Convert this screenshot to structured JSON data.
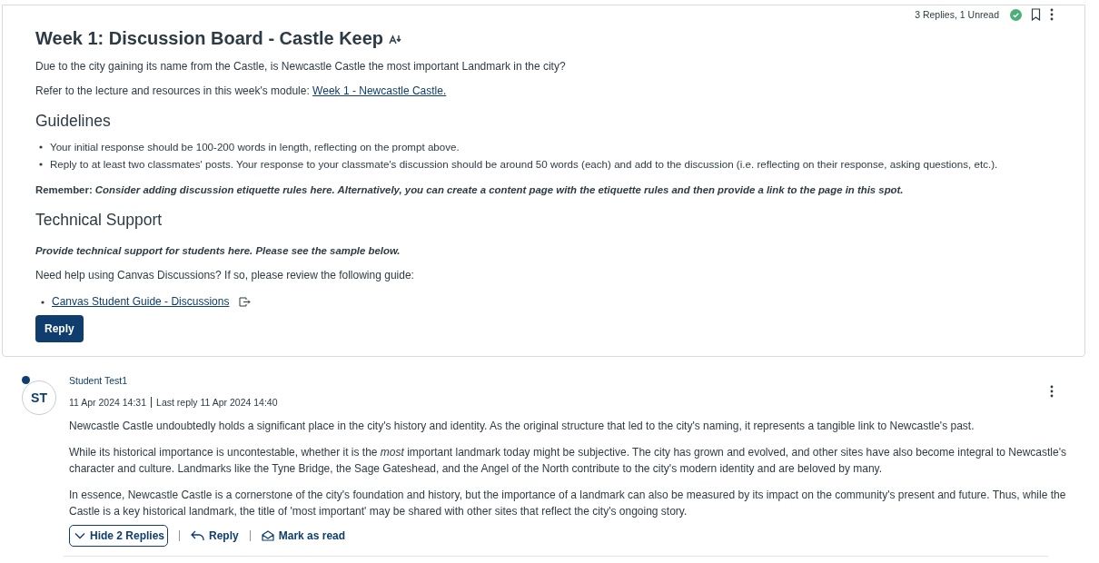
{
  "topic": {
    "status": "3 Replies, 1 Unread",
    "published": true,
    "bookmarked": false,
    "title": "Week 1: Discussion Board - Castle Keep",
    "blocks": [
      {
        "kind": "paragraph",
        "text": "Due to the city gaining its name from the Castle, is Newcastle Castle the most important Landmark in the city?"
      },
      {
        "kind": "paragraph",
        "text": "Refer to the lecture and resources in this week's module: ",
        "link": "Week 1 - Newcastle Castle."
      },
      {
        "kind": "heading",
        "text": "Guidelines"
      },
      {
        "kind": "list",
        "items": [
          "Your initial response should be 100-200 words in length, reflecting on the prompt above.",
          "Reply to at least two classmates' posts. Your response to your classmate's discussion should be around 50 words (each) and add to the discussion (i.e. reflecting on their response, asking questions, etc.)."
        ]
      },
      {
        "kind": "note",
        "text": "Remember: *Consider adding discussion etiquette rules here. Alternatively, you can create a content page with the etiquette rules and then provide a link to the page in this spot.*"
      },
      {
        "kind": "heading",
        "text": "Technical Support"
      },
      {
        "kind": "emphasis",
        "text": "Provide technical support for students here. Please see the sample below."
      },
      {
        "kind": "paragraph",
        "text": "Need help using Canvas Discussions? If so, please review the following guide:"
      },
      {
        "kind": "links",
        "items": [
          "Canvas Student Guide - Discussions"
        ]
      }
    ],
    "reply_button": "Reply"
  },
  "entry": {
    "initials": "ST",
    "unread": true,
    "author": "Student Test1",
    "posted": "11 Apr 2024 14:31",
    "last_reply": "Last reply 11 Apr 2024 14:40",
    "paragraphs": [
      "Newcastle Castle undoubtedly holds a significant place in the city's history and identity. As the original structure that led to the city's naming, it represents a tangible link to Newcastle's past.",
      "While its historical importance is uncontestable, whether it is the *most* important landmark today might be subjective. The city has grown and evolved, and other sites have also become integral to Newcastle's character and culture. Landmarks like the Tyne Bridge, the Sage Gateshead, and the Angel of the North contribute to the city's modern identity and are beloved by many.",
      "In essence, Newcastle Castle is a cornerstone of the city's foundation and history, but the importance of a landmark can also be measured by its impact on the community's present and future. Thus, while the Castle is a key historical landmark, the title of 'most important' may be shared with other sites that reflect the city's ongoing story."
    ],
    "actions": {
      "toggle": "Hide 2 Replies",
      "reply": "Reply",
      "mark": "Mark as read"
    }
  }
}
